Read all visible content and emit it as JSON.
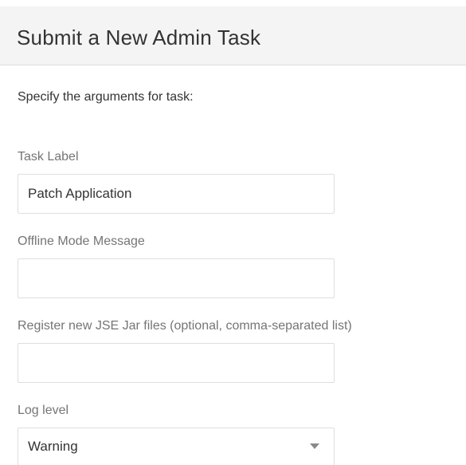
{
  "header": {
    "title": "Submit a New Admin Task"
  },
  "form": {
    "instructions": "Specify the arguments for task:",
    "task_label": {
      "label": "Task Label",
      "value": "Patch Application",
      "placeholder": ""
    },
    "offline_mode_message": {
      "label": "Offline Mode Message",
      "value": "",
      "placeholder": ""
    },
    "jse_jar_files": {
      "label": "Register new JSE Jar files (optional, comma-separated list)",
      "value": "",
      "placeholder": ""
    },
    "log_level": {
      "label": "Log level",
      "selected": "Warning",
      "icon": "chevron-down-icon"
    }
  }
}
